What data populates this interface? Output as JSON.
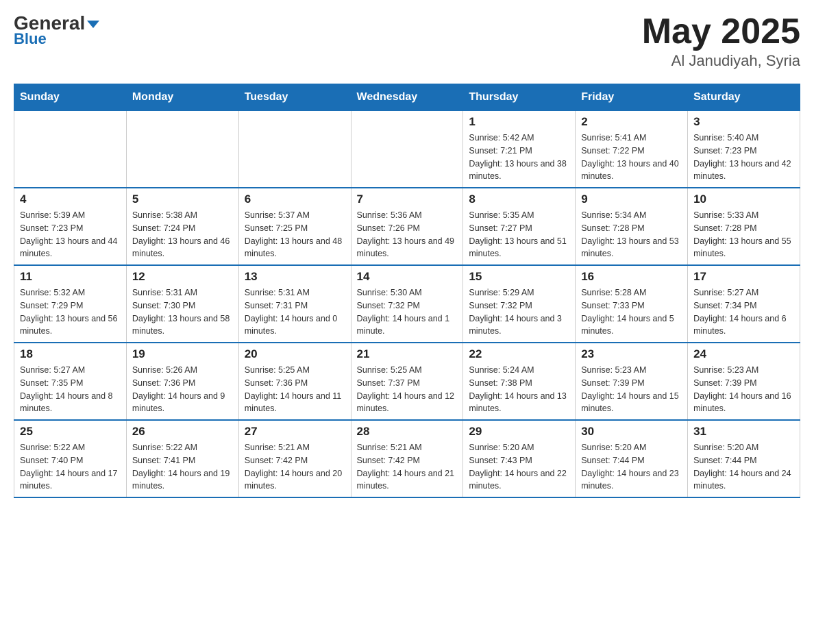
{
  "header": {
    "logo_main": "General",
    "logo_sub": "Blue",
    "month_year": "May 2025",
    "location": "Al Janudiyah, Syria"
  },
  "weekdays": [
    "Sunday",
    "Monday",
    "Tuesday",
    "Wednesday",
    "Thursday",
    "Friday",
    "Saturday"
  ],
  "weeks": [
    [
      {
        "day": "",
        "sunrise": "",
        "sunset": "",
        "daylight": ""
      },
      {
        "day": "",
        "sunrise": "",
        "sunset": "",
        "daylight": ""
      },
      {
        "day": "",
        "sunrise": "",
        "sunset": "",
        "daylight": ""
      },
      {
        "day": "",
        "sunrise": "",
        "sunset": "",
        "daylight": ""
      },
      {
        "day": "1",
        "sunrise": "Sunrise: 5:42 AM",
        "sunset": "Sunset: 7:21 PM",
        "daylight": "Daylight: 13 hours and 38 minutes."
      },
      {
        "day": "2",
        "sunrise": "Sunrise: 5:41 AM",
        "sunset": "Sunset: 7:22 PM",
        "daylight": "Daylight: 13 hours and 40 minutes."
      },
      {
        "day": "3",
        "sunrise": "Sunrise: 5:40 AM",
        "sunset": "Sunset: 7:23 PM",
        "daylight": "Daylight: 13 hours and 42 minutes."
      }
    ],
    [
      {
        "day": "4",
        "sunrise": "Sunrise: 5:39 AM",
        "sunset": "Sunset: 7:23 PM",
        "daylight": "Daylight: 13 hours and 44 minutes."
      },
      {
        "day": "5",
        "sunrise": "Sunrise: 5:38 AM",
        "sunset": "Sunset: 7:24 PM",
        "daylight": "Daylight: 13 hours and 46 minutes."
      },
      {
        "day": "6",
        "sunrise": "Sunrise: 5:37 AM",
        "sunset": "Sunset: 7:25 PM",
        "daylight": "Daylight: 13 hours and 48 minutes."
      },
      {
        "day": "7",
        "sunrise": "Sunrise: 5:36 AM",
        "sunset": "Sunset: 7:26 PM",
        "daylight": "Daylight: 13 hours and 49 minutes."
      },
      {
        "day": "8",
        "sunrise": "Sunrise: 5:35 AM",
        "sunset": "Sunset: 7:27 PM",
        "daylight": "Daylight: 13 hours and 51 minutes."
      },
      {
        "day": "9",
        "sunrise": "Sunrise: 5:34 AM",
        "sunset": "Sunset: 7:28 PM",
        "daylight": "Daylight: 13 hours and 53 minutes."
      },
      {
        "day": "10",
        "sunrise": "Sunrise: 5:33 AM",
        "sunset": "Sunset: 7:28 PM",
        "daylight": "Daylight: 13 hours and 55 minutes."
      }
    ],
    [
      {
        "day": "11",
        "sunrise": "Sunrise: 5:32 AM",
        "sunset": "Sunset: 7:29 PM",
        "daylight": "Daylight: 13 hours and 56 minutes."
      },
      {
        "day": "12",
        "sunrise": "Sunrise: 5:31 AM",
        "sunset": "Sunset: 7:30 PM",
        "daylight": "Daylight: 13 hours and 58 minutes."
      },
      {
        "day": "13",
        "sunrise": "Sunrise: 5:31 AM",
        "sunset": "Sunset: 7:31 PM",
        "daylight": "Daylight: 14 hours and 0 minutes."
      },
      {
        "day": "14",
        "sunrise": "Sunrise: 5:30 AM",
        "sunset": "Sunset: 7:32 PM",
        "daylight": "Daylight: 14 hours and 1 minute."
      },
      {
        "day": "15",
        "sunrise": "Sunrise: 5:29 AM",
        "sunset": "Sunset: 7:32 PM",
        "daylight": "Daylight: 14 hours and 3 minutes."
      },
      {
        "day": "16",
        "sunrise": "Sunrise: 5:28 AM",
        "sunset": "Sunset: 7:33 PM",
        "daylight": "Daylight: 14 hours and 5 minutes."
      },
      {
        "day": "17",
        "sunrise": "Sunrise: 5:27 AM",
        "sunset": "Sunset: 7:34 PM",
        "daylight": "Daylight: 14 hours and 6 minutes."
      }
    ],
    [
      {
        "day": "18",
        "sunrise": "Sunrise: 5:27 AM",
        "sunset": "Sunset: 7:35 PM",
        "daylight": "Daylight: 14 hours and 8 minutes."
      },
      {
        "day": "19",
        "sunrise": "Sunrise: 5:26 AM",
        "sunset": "Sunset: 7:36 PM",
        "daylight": "Daylight: 14 hours and 9 minutes."
      },
      {
        "day": "20",
        "sunrise": "Sunrise: 5:25 AM",
        "sunset": "Sunset: 7:36 PM",
        "daylight": "Daylight: 14 hours and 11 minutes."
      },
      {
        "day": "21",
        "sunrise": "Sunrise: 5:25 AM",
        "sunset": "Sunset: 7:37 PM",
        "daylight": "Daylight: 14 hours and 12 minutes."
      },
      {
        "day": "22",
        "sunrise": "Sunrise: 5:24 AM",
        "sunset": "Sunset: 7:38 PM",
        "daylight": "Daylight: 14 hours and 13 minutes."
      },
      {
        "day": "23",
        "sunrise": "Sunrise: 5:23 AM",
        "sunset": "Sunset: 7:39 PM",
        "daylight": "Daylight: 14 hours and 15 minutes."
      },
      {
        "day": "24",
        "sunrise": "Sunrise: 5:23 AM",
        "sunset": "Sunset: 7:39 PM",
        "daylight": "Daylight: 14 hours and 16 minutes."
      }
    ],
    [
      {
        "day": "25",
        "sunrise": "Sunrise: 5:22 AM",
        "sunset": "Sunset: 7:40 PM",
        "daylight": "Daylight: 14 hours and 17 minutes."
      },
      {
        "day": "26",
        "sunrise": "Sunrise: 5:22 AM",
        "sunset": "Sunset: 7:41 PM",
        "daylight": "Daylight: 14 hours and 19 minutes."
      },
      {
        "day": "27",
        "sunrise": "Sunrise: 5:21 AM",
        "sunset": "Sunset: 7:42 PM",
        "daylight": "Daylight: 14 hours and 20 minutes."
      },
      {
        "day": "28",
        "sunrise": "Sunrise: 5:21 AM",
        "sunset": "Sunset: 7:42 PM",
        "daylight": "Daylight: 14 hours and 21 minutes."
      },
      {
        "day": "29",
        "sunrise": "Sunrise: 5:20 AM",
        "sunset": "Sunset: 7:43 PM",
        "daylight": "Daylight: 14 hours and 22 minutes."
      },
      {
        "day": "30",
        "sunrise": "Sunrise: 5:20 AM",
        "sunset": "Sunset: 7:44 PM",
        "daylight": "Daylight: 14 hours and 23 minutes."
      },
      {
        "day": "31",
        "sunrise": "Sunrise: 5:20 AM",
        "sunset": "Sunset: 7:44 PM",
        "daylight": "Daylight: 14 hours and 24 minutes."
      }
    ]
  ]
}
